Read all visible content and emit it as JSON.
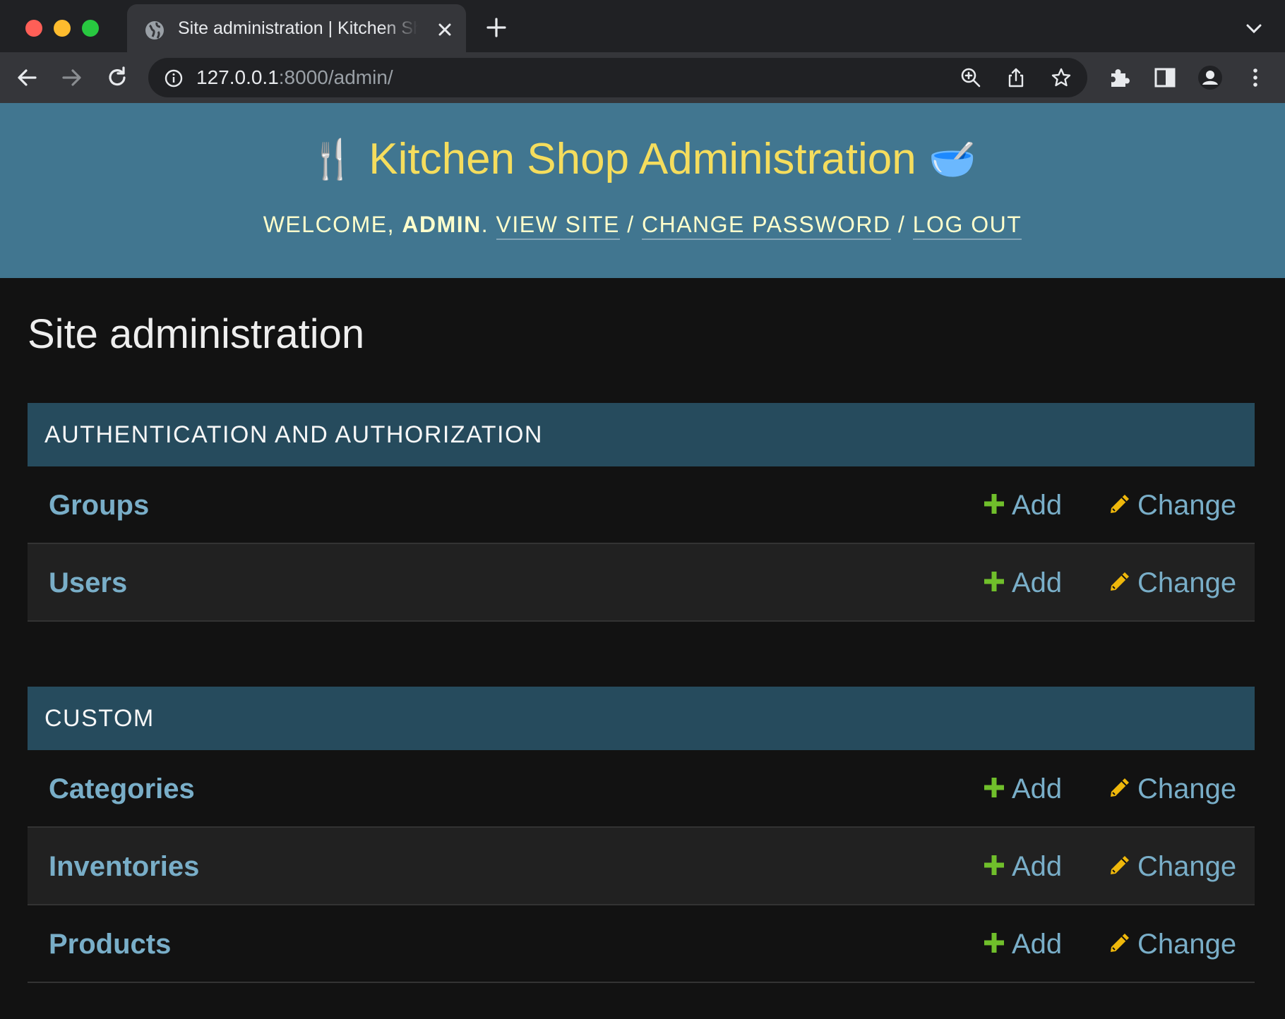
{
  "browser": {
    "tab_title": "Site administration | Kitchen Shop Administration",
    "url_host": "127.0.0.1",
    "url_rest": ":8000/admin/"
  },
  "header": {
    "emoji_left": "🍴",
    "branding": "Kitchen Shop Administration",
    "emoji_right": "🥣",
    "welcome": "WELCOME,",
    "username": "ADMIN",
    "username_suffix": ".",
    "view_site": "VIEW SITE",
    "change_password": "CHANGE PASSWORD",
    "log_out": "LOG OUT",
    "separator": "/"
  },
  "page_title": "Site administration",
  "modules": [
    {
      "caption": "AUTHENTICATION AND AUTHORIZATION",
      "models": [
        {
          "name": "Groups",
          "add": "Add",
          "change": "Change"
        },
        {
          "name": "Users",
          "add": "Add",
          "change": "Change"
        }
      ]
    },
    {
      "caption": "CUSTOM",
      "models": [
        {
          "name": "Categories",
          "add": "Add",
          "change": "Change"
        },
        {
          "name": "Inventories",
          "add": "Add",
          "change": "Change"
        },
        {
          "name": "Products",
          "add": "Add",
          "change": "Change"
        }
      ]
    }
  ],
  "colors": {
    "header_bg": "#417690",
    "branding": "#f5dd5d",
    "module_caption_bg": "#264b5d",
    "link": "#79aec8",
    "add_icon": "#70bf2b",
    "change_icon": "#efb80b"
  },
  "icons": {
    "add": "plus-icon",
    "change": "pencil-icon"
  }
}
